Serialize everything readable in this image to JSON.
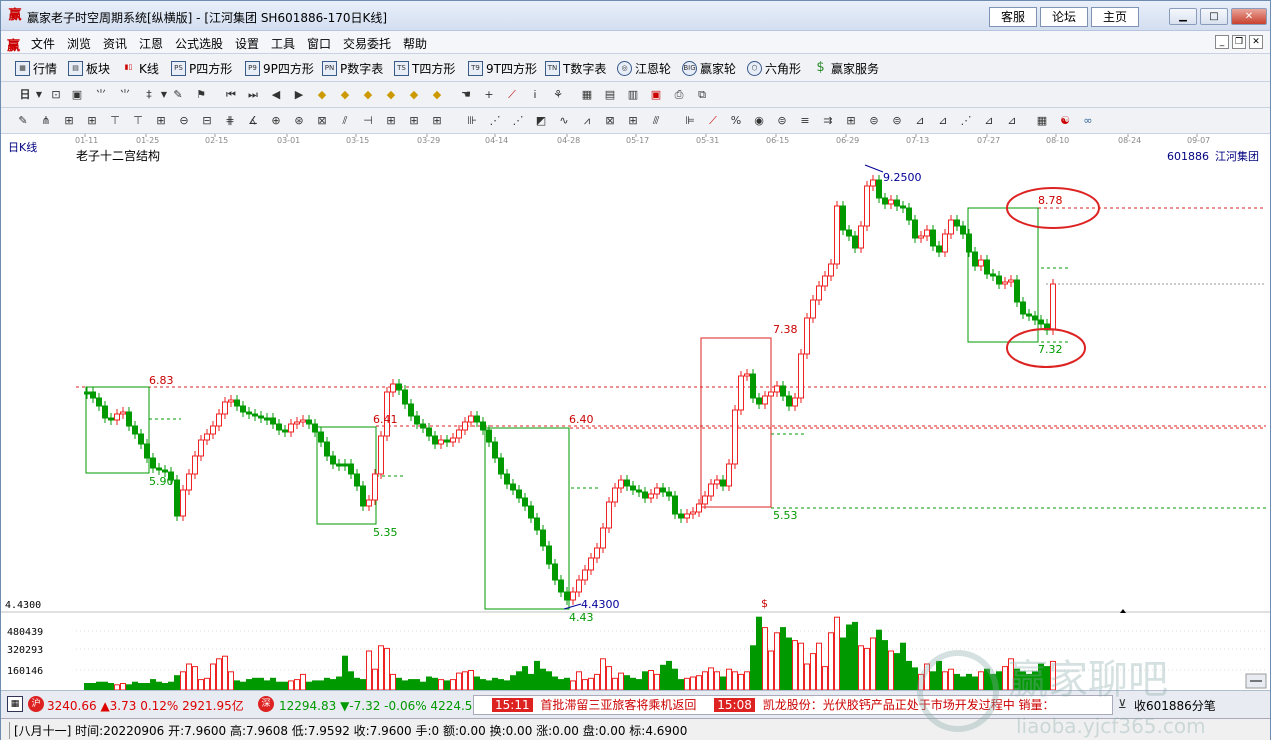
{
  "window": {
    "app_icon": "赢",
    "title": "赢家老子时空周期系统[纵横版] - [江河集团  SH601886-170日K线]",
    "title_links": [
      "客服",
      "论坛",
      "主页"
    ],
    "controls": [
      "minimize-icon",
      "maximize-icon",
      "close-icon"
    ]
  },
  "menu": {
    "logo": "赢",
    "items": [
      "文件",
      "浏览",
      "资讯",
      "江恩",
      "公式选股",
      "设置",
      "工具",
      "窗口",
      "交易委托",
      "帮助"
    ]
  },
  "toolbar1": {
    "items": [
      {
        "label": "行情",
        "icon": "grid-icon"
      },
      {
        "label": "板块",
        "icon": "blocks-icon"
      },
      {
        "label": "K线",
        "icon": "kline-icon"
      },
      {
        "label": "P四方形",
        "icon": "PS"
      },
      {
        "label": "9P四方形",
        "icon": "P9"
      },
      {
        "label": "P数字表",
        "icon": "PN"
      },
      {
        "label": "T四方形",
        "icon": "TS"
      },
      {
        "label": "9T四方形",
        "icon": "T9"
      },
      {
        "label": "T数字表",
        "icon": "TN"
      },
      {
        "label": "江恩轮",
        "icon": "wheel-icon"
      },
      {
        "label": "赢家轮",
        "icon": "BIG"
      },
      {
        "label": "六角形",
        "icon": "hexagon-icon"
      },
      {
        "label": "赢家服务",
        "icon": "dollar-icon"
      }
    ]
  },
  "toolbar2": {
    "period_label": "日"
  },
  "chart": {
    "period_label": "日K线",
    "indicator_title": "老子十二宫结构",
    "stock_code": "601886",
    "stock_name": "江河集团",
    "date_ticks": [
      "01-11",
      "01-25",
      "02-15",
      "03-01",
      "03-15",
      "03-29",
      "04-14",
      "04-28",
      "05-17",
      "05-31",
      "06-15",
      "06-29",
      "07-13",
      "07-27",
      "08-10",
      "08-24",
      "09-07"
    ],
    "price_levels": [
      {
        "label": "6.83",
        "color": "#cc0000"
      },
      {
        "label": "6.41",
        "color": "#cc0000"
      },
      {
        "label": "6.40",
        "color": "#cc0000"
      },
      {
        "label": "7.38",
        "color": "#cc0000"
      },
      {
        "label": "8.78",
        "color": "#cc0000"
      },
      {
        "label": "5.90",
        "color": "#009900"
      },
      {
        "label": "5.35",
        "color": "#009900"
      },
      {
        "label": "4.43",
        "color": "#009900"
      },
      {
        "label": "5.53",
        "color": "#009900"
      },
      {
        "label": "7.32",
        "color": "#009900"
      }
    ],
    "high_label": "9.2500",
    "low_label": "4.4300",
    "low_axis_label": "4.4300",
    "volume_axis": [
      "480439",
      "320293",
      "160146"
    ],
    "marker": "$",
    "up_color": "#ee2222",
    "down_color": "#009900"
  },
  "bottombar": {
    "sh_index": "3240.66 ▲3.73 0.12% 2921.95亿",
    "sz_index": "12294.83 ▼-7.32 -0.06% 4224.52亿",
    "news": [
      {
        "time": "15:11",
        "text": "首批滞留三亚旅客将乘机返回"
      },
      {
        "time": "15:08",
        "text": "凯龙股份：光伏胶钙产品正处于市场开发过程中 销量："
      }
    ],
    "right_label": "收601886分笔"
  },
  "statusbar": {
    "text": "[八月十一] 时间:20220906 开:7.9600 高:7.9608 低:7.9592 收:7.9600 手:0 额:0.00 换:0.00 涨:0.00 盘:0.00 标:4.6900"
  },
  "watermark": {
    "line1": "赢家聊吧",
    "line2": "liaoba.yjcf365.com"
  }
}
